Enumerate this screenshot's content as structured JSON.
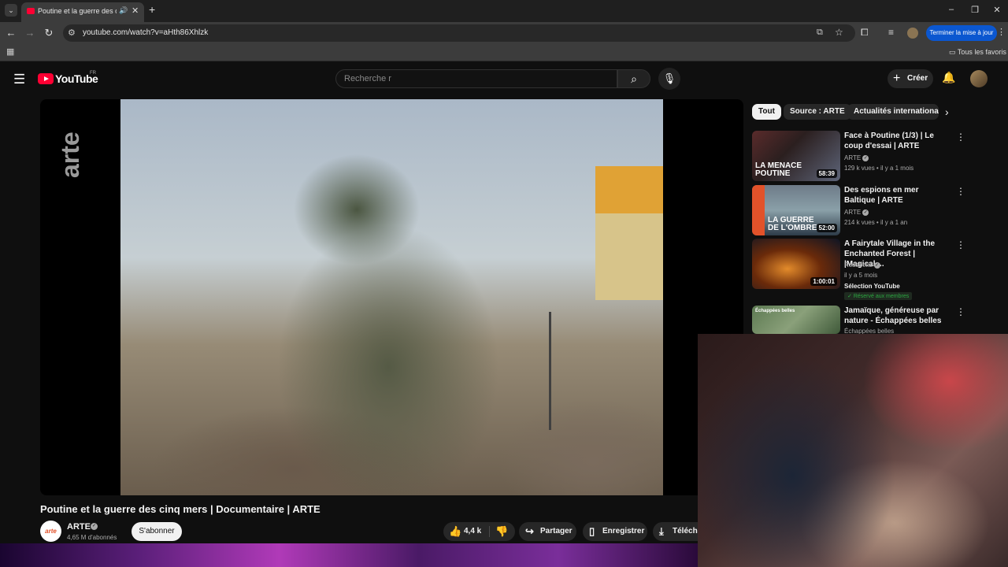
{
  "browser": {
    "tab_title": "Poutine et la guerre des cinq mers | Documentaire | ARTE - YouTube",
    "url": "youtube.com/watch?v=aHth86Xhlzk",
    "update_button": "Terminer la mise à jour",
    "bookmarks_all": "Tous les favoris"
  },
  "header": {
    "logo_text": "YouTube",
    "country": "FR",
    "search_placeholder": "Recherche r",
    "create_label": "Créer"
  },
  "player": {
    "watermark": "arte"
  },
  "video": {
    "title": "Poutine et la guerre des cinq mers | Documentaire | ARTE",
    "channel_avatar_text": "arte",
    "channel_name": "ARTE",
    "subscribers": "4,65 M d'abonnés",
    "subscribe_label": "S'abonner",
    "likes": "4,4 k",
    "share_label": "Partager",
    "save_label": "Enregistrer",
    "download_label": "Télécharger"
  },
  "chips": [
    "Tout",
    "Source : ARTE",
    "Actualités internationales"
  ],
  "recommendations": [
    {
      "title": "Face à Poutine (1/3) | Le coup d'essai | ARTE",
      "channel": "ARTE",
      "meta": "129 k vues • il y a 1 mois",
      "duration": "58:39",
      "thumb_text": "LA MENACE POUTINE"
    },
    {
      "title": "Des espions en mer Baltique | ARTE",
      "channel": "ARTE",
      "meta": "214 k vues • il y a 1 an",
      "duration": "52:00",
      "thumb_text": "LA GUERRE DE L'OMBRE"
    },
    {
      "title": "A Fairytale Village in the Enchanted Forest | |Magical ...",
      "channel": "Rosabella",
      "meta": "il y a 5 mois",
      "duration": "1:00:01",
      "badge": "Sélection YouTube",
      "members_badge": "Réservé aux membres"
    },
    {
      "title": "Jamaïque, généreuse par nature - Échappées belles",
      "channel": "Échappées belles",
      "thumb_text": "Échappées belles"
    }
  ]
}
